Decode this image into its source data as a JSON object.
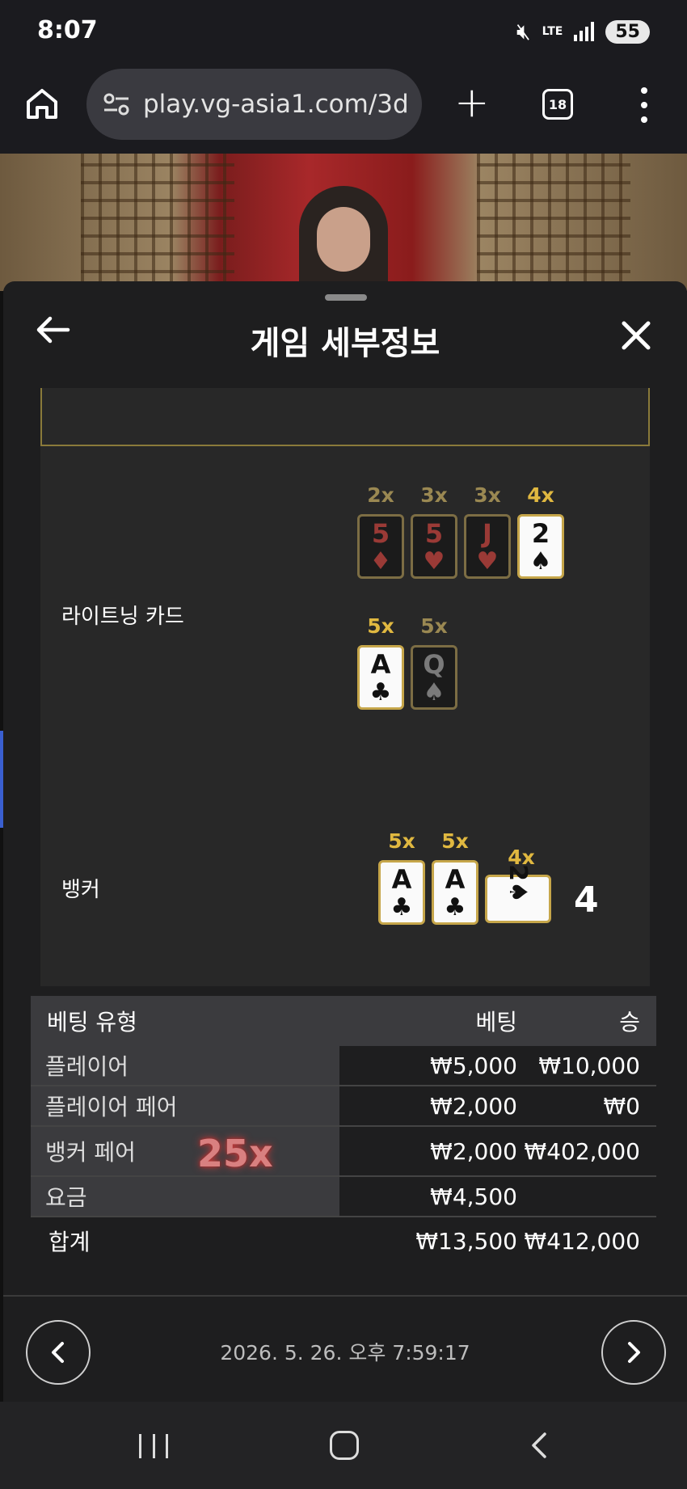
{
  "status_bar": {
    "time": "8:07",
    "network": "LTE",
    "battery": "55"
  },
  "browser": {
    "url": "play.vg-asia1.com/3d",
    "tab_count": "18"
  },
  "panel": {
    "title": "게임 세부정보"
  },
  "lightning": {
    "label": "라이트닝 카드",
    "row1": [
      {
        "mult": "2x",
        "rank": "5",
        "suit": "♦",
        "color": "red",
        "dim": true
      },
      {
        "mult": "3x",
        "rank": "5",
        "suit": "♥",
        "color": "red",
        "dim": true
      },
      {
        "mult": "3x",
        "rank": "J",
        "suit": "♥",
        "color": "red",
        "dim": true
      },
      {
        "mult": "4x",
        "rank": "2",
        "suit": "♠",
        "color": "black",
        "dim": false
      }
    ],
    "row2": [
      {
        "mult": "5x",
        "rank": "A",
        "suit": "♣",
        "color": "black",
        "dim": false
      },
      {
        "mult": "5x",
        "rank": "Q",
        "suit": "♠",
        "color": "black",
        "dim": true
      }
    ]
  },
  "banker": {
    "label": "뱅커",
    "cards": [
      {
        "mult": "5x",
        "rank": "A",
        "suit": "♣"
      },
      {
        "mult": "5x",
        "rank": "A",
        "suit": "♣"
      },
      {
        "mult": "4x",
        "rank": "2",
        "suit": "♠"
      }
    ],
    "score": "4"
  },
  "bet_table": {
    "headers": {
      "type": "베팅 유형",
      "bet": "베팅",
      "win": "승"
    },
    "rows": [
      {
        "type": "플레이어",
        "bet": "₩5,000",
        "win": "₩10,000"
      },
      {
        "type": "플레이어 페어",
        "bet": "₩2,000",
        "win": "₩0"
      },
      {
        "type": "뱅커 페어",
        "bet": "₩2,000",
        "win": "₩402,000",
        "multiplier": "25x"
      },
      {
        "type": "요금",
        "bet": "₩4,500",
        "win": ""
      }
    ],
    "total": {
      "label": "합계",
      "bet": "₩13,500",
      "win": "₩412,000"
    }
  },
  "footer": {
    "timestamp": "2026. 5. 26. 오후 7:59:17"
  },
  "icons": {
    "home": "home-icon",
    "tune": "tune-icon",
    "add": "plus-icon",
    "tabs": "tabs-icon",
    "menu": "more-vert-icon",
    "back": "arrow-left-icon",
    "close": "close-icon",
    "trophy": "trophy-icon",
    "prev": "chevron-left-icon",
    "next": "chevron-right-icon"
  },
  "colors": {
    "accent_gold": "#e0b840",
    "panel_bg": "#1e1e1f",
    "multiplier_red": "#d98080"
  }
}
